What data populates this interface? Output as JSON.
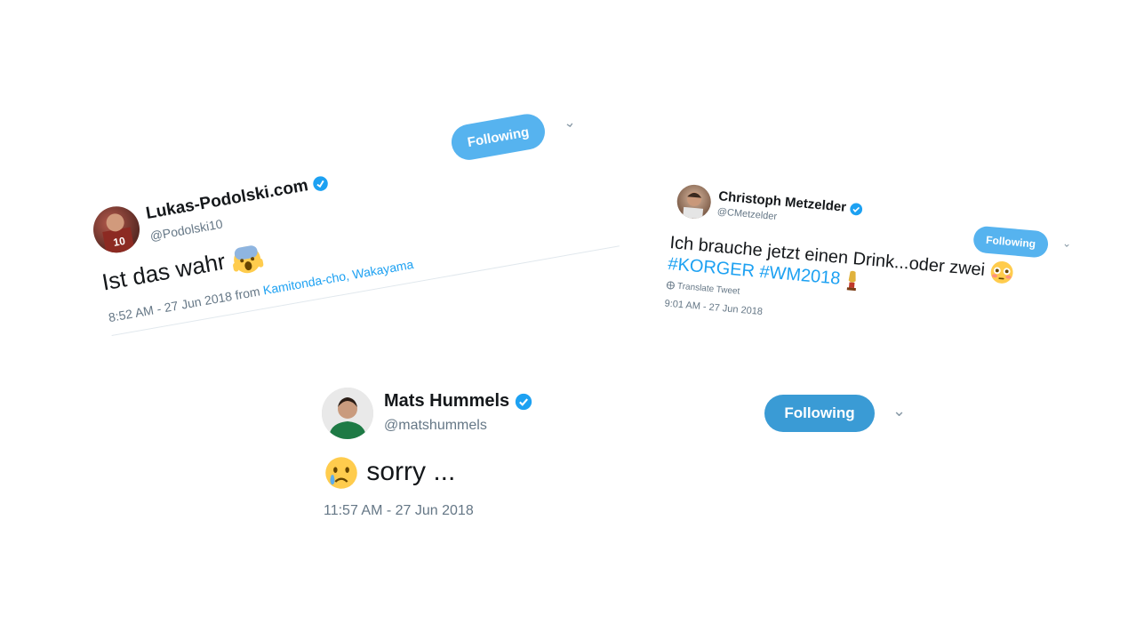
{
  "tweets": [
    {
      "name": "Lukas-Podolski.com",
      "handle": "@Podolski10",
      "follow_label": "Following",
      "text": "Ist das wahr",
      "timestamp": "8:52 AM - 27 Jun 2018 from",
      "location": "Kamitonda-cho, Wakayama"
    },
    {
      "name": "Christoph Metzelder",
      "handle": "@CMetzelder",
      "follow_label": "Following",
      "text": "Ich brauche jetzt einen Drink...oder zwei",
      "hashtags": "#KORGER #WM2018",
      "translate": "Translate Tweet",
      "timestamp": "9:01 AM - 27 Jun 2018"
    },
    {
      "name": "Mats Hummels",
      "handle": "@matshummels",
      "follow_label": "Following",
      "text": "sorry ...",
      "timestamp": "11:57 AM - 27 Jun 2018"
    }
  ],
  "colors": {
    "brand_blue": "#1da1f2",
    "follow_light": "#56b3ef",
    "follow_dark": "#3a9bd5",
    "secondary_text": "#657786"
  },
  "icons": [
    "verified-badge-icon",
    "chevron-down-icon",
    "globe-icon",
    "screaming-emoji-icon",
    "flushed-emoji-icon",
    "crying-emoji-icon",
    "world-cup-trophy-icon"
  ]
}
